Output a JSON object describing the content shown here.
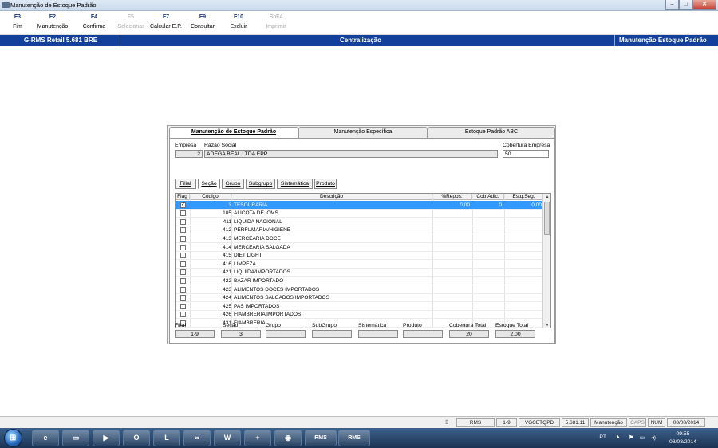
{
  "window": {
    "title": "Manutenção de Estoque Padrão"
  },
  "toolbar": [
    {
      "key": "F3",
      "label": "Fim",
      "enabled": true
    },
    {
      "key": "F2",
      "label": "Manutenção",
      "enabled": true
    },
    {
      "key": "F4",
      "label": "Confirma",
      "enabled": true
    },
    {
      "key": "F5",
      "label": "Selecionar",
      "enabled": false
    },
    {
      "key": "F7",
      "label": "Calcular E.P.",
      "enabled": true
    },
    {
      "key": "F9",
      "label": "Consultar",
      "enabled": true
    },
    {
      "key": "F10",
      "label": "Excluir",
      "enabled": true
    },
    {
      "key": "ShF4",
      "label": "Imprimir",
      "enabled": false
    }
  ],
  "bluebar": {
    "left": "G-RMS Retail 5.681 BRE",
    "center": "Centralização",
    "right": "Manutenção Estoque Padrão"
  },
  "tabs": [
    {
      "label": "Manutenção de Estoque Padrão",
      "active": true
    },
    {
      "label": "Manutenção Específica",
      "active": false
    },
    {
      "label": "Estoque Padrão ABC",
      "active": false
    }
  ],
  "empresa": {
    "empresa_label": "Empresa",
    "empresa_value": "2",
    "razao_label": "Razão Social",
    "razao_value": "ADEGA BEAL LTDA EPP",
    "cobertura_label": "Cobertura Empresa",
    "cobertura_value": "50"
  },
  "subtabs": [
    "Filial",
    "Seção",
    "Grupo",
    "Subgrupo",
    "Sistemática",
    "Produto"
  ],
  "grid": {
    "columns": [
      "Flag",
      "Código",
      "Descrição",
      "%Repos.",
      "Cob.Adic.",
      "Estq.Seg."
    ],
    "rows": [
      {
        "flag": true,
        "code": "3",
        "desc": "TESOURARIA",
        "repos": "0,00",
        "cob": "0",
        "estq": "0,00",
        "selected": true
      },
      {
        "flag": false,
        "code": "105",
        "desc": "ALICOTA DE ICMS"
      },
      {
        "flag": false,
        "code": "411",
        "desc": "LIQUIDA NACIONAL"
      },
      {
        "flag": false,
        "code": "412",
        "desc": "PERFUMARIA/HIGIENE"
      },
      {
        "flag": false,
        "code": "413",
        "desc": "MERCEARIA DOCE"
      },
      {
        "flag": false,
        "code": "414",
        "desc": "MERCEARIA SALGADA"
      },
      {
        "flag": false,
        "code": "415",
        "desc": "DIET LIGHT"
      },
      {
        "flag": false,
        "code": "416",
        "desc": "LIMPEZA"
      },
      {
        "flag": false,
        "code": "421",
        "desc": "LIQUIDA/IMPORTADOS"
      },
      {
        "flag": false,
        "code": "422",
        "desc": "BAZAR IMPORTADO"
      },
      {
        "flag": false,
        "code": "423",
        "desc": "ALIMENTOS DOCES IMPORTADOS"
      },
      {
        "flag": false,
        "code": "424",
        "desc": "ALIMENTOS SALGADOS IMPORTADOS"
      },
      {
        "flag": false,
        "code": "425",
        "desc": "PAS IMPORTADOS"
      },
      {
        "flag": false,
        "code": "426",
        "desc": "FIAMBRERIA IMPORTADOS"
      },
      {
        "flag": false,
        "code": "431",
        "desc": "FIAMBRERIA"
      }
    ]
  },
  "footer": [
    {
      "label": "Filial",
      "value": "1-9"
    },
    {
      "label": "Seção",
      "value": "3"
    },
    {
      "label": "Grupo",
      "value": ""
    },
    {
      "label": "SubGrupo",
      "value": ""
    },
    {
      "label": "Sistemática",
      "value": ""
    },
    {
      "label": "Produto",
      "value": ""
    },
    {
      "label": "Cobertura Total",
      "value": "20"
    },
    {
      "label": "Estoque Total",
      "value": "2,00"
    }
  ],
  "statusbar": [
    "RMS",
    "1-9",
    "VGCETQPD",
    "5.681.11",
    "Manutenção",
    "CAPS",
    "NUM",
    "08/08/2014"
  ],
  "taskbar": {
    "app_labels": [
      "RMS",
      "RMS"
    ],
    "tray_lang": "PT",
    "time": "09:55",
    "date": "08/08/2014"
  },
  "colors": {
    "accent": "#12409a",
    "selection": "#3399ff"
  }
}
